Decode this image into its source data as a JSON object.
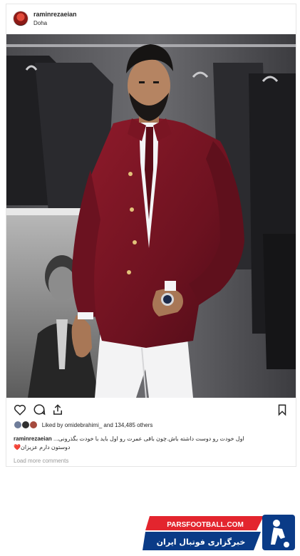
{
  "post": {
    "username": "raminrezaeian",
    "location": "Doha"
  },
  "likes": {
    "text": "Liked by omidebrahimi_ and 134,485 others"
  },
  "caption": {
    "username": "raminrezaeian",
    "line1": "اول خودت رو دوست داشته باش.چون باقی عمرت رو اول باید با خودت بگذرونی...",
    "line2": "دوستون دارم عزیزان❤️"
  },
  "comments": {
    "load_more": "Load more comments"
  },
  "watermark": {
    "site": "PARSFOOTBALL.COM",
    "tagline": "خبرگزاری فوتبال ایران"
  },
  "colors": {
    "jacket": "#7a1523",
    "watermark_blue": "#0a3b87",
    "watermark_red": "#e3252e"
  }
}
